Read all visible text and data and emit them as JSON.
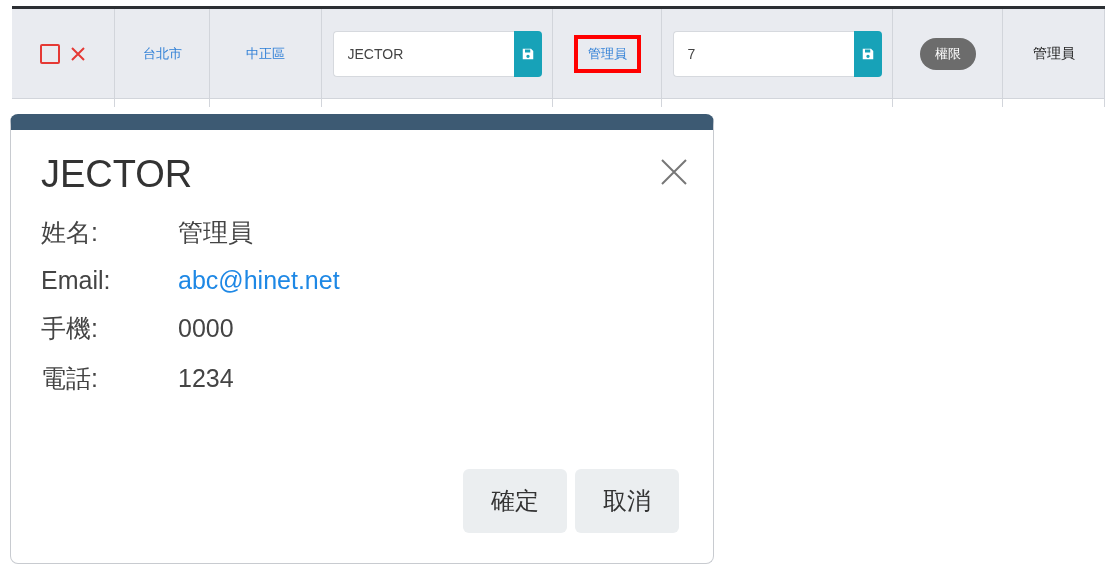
{
  "table_row": {
    "cells": [
      {
        "kind": "actions",
        "checked": false
      },
      {
        "kind": "link",
        "text": "台北市",
        "highlighted": false
      },
      {
        "kind": "link",
        "text": "中正區",
        "highlighted": false
      },
      {
        "kind": "input",
        "value": "JECTOR"
      },
      {
        "kind": "link",
        "text": "管理員",
        "highlighted": true
      },
      {
        "kind": "input",
        "value": "7"
      },
      {
        "kind": "badge",
        "text": "權限"
      },
      {
        "kind": "text",
        "text": "管理員"
      }
    ]
  },
  "dialog": {
    "title": "JECTOR",
    "fields": [
      {
        "label": "姓名:",
        "value": "管理員",
        "kind": "text"
      },
      {
        "label": "Email:",
        "value": "abc@hinet.net",
        "kind": "link"
      },
      {
        "label": "手機:",
        "value": "0000",
        "kind": "text"
      },
      {
        "label": "電話:",
        "value": "1234",
        "kind": "text"
      }
    ],
    "buttons": [
      "確定",
      "取消"
    ]
  }
}
